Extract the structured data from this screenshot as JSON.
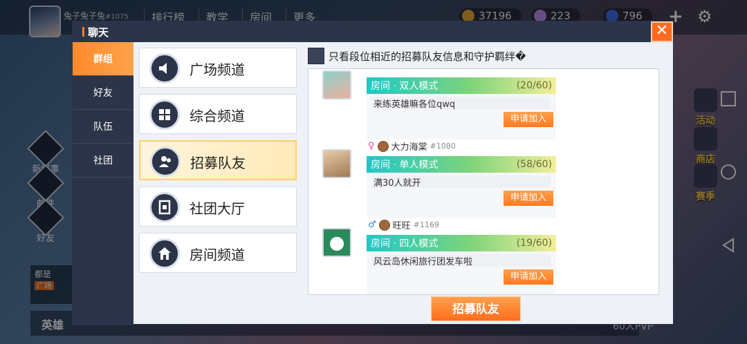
{
  "background": {
    "player_name": "兔子兔子兔",
    "player_uid": "#1075",
    "top_nav": [
      "排行榜",
      "教学",
      "房间",
      "更多"
    ],
    "currencies": [
      {
        "icon": "gold-coin-icon",
        "value": "37196",
        "color": "#e9a93a"
      },
      {
        "icon": "crystal-icon",
        "value": "223",
        "color": "#b98cf0"
      },
      {
        "icon": "gem-icon",
        "value": "796",
        "color": "#3a6ee9"
      }
    ],
    "left_items": [
      "新鲜事",
      "邮件",
      "好友"
    ],
    "right_items": [
      "活动",
      "商店",
      "赛季"
    ],
    "news_tag": "广场",
    "news_text": "都是",
    "bottom_label": "英雄",
    "pvp_label": "60人PVP"
  },
  "chat": {
    "title": "聊天",
    "close_label": "✕",
    "side_tabs": [
      {
        "label": "群组",
        "active": true
      },
      {
        "label": "好友",
        "active": false
      },
      {
        "label": "队伍",
        "active": false
      },
      {
        "label": "社团",
        "active": false
      }
    ],
    "channels": [
      {
        "label": "广场频道",
        "icon": "speaker-icon",
        "active": false
      },
      {
        "label": "综合频道",
        "icon": "grid-icon",
        "active": false
      },
      {
        "label": "招募队友",
        "icon": "users-icon",
        "active": true
      },
      {
        "label": "社团大厅",
        "icon": "bookmark-icon",
        "active": false
      },
      {
        "label": "房间频道",
        "icon": "home-icon",
        "active": false
      }
    ],
    "filter_label": "只看段位相近的招募队友信息和守护羁绊�",
    "messages": [
      {
        "name": "",
        "uid": "",
        "gender": "",
        "room_mode": "房间 · 双人模式",
        "room_count": "(20/60)",
        "text": "来练英雄嘛各位qwq",
        "join_label": "申请加入",
        "avatar_colors": [
          "#8fd1c8",
          "#e9b0a0"
        ]
      },
      {
        "name": "大力海棠",
        "uid": "#1080",
        "gender": "♀",
        "gender_color": "#e2499b",
        "room_mode": "房间 · 单人模式",
        "room_count": "(58/60)",
        "text": "满30人就开",
        "join_label": "申请加入",
        "avatar_colors": [
          "#e7c9a6",
          "#a07a55"
        ]
      },
      {
        "name": "旺旺",
        "uid": "#1169",
        "gender": "♂",
        "gender_color": "#2d82e0",
        "room_mode": "房间 · 四人模式",
        "room_count": "(19/60)",
        "text": "风云岛休闲旅行团发车啦",
        "join_label": "申请加入",
        "avatar_colors": [
          "#ffffff",
          "#2a8a5a"
        ]
      }
    ],
    "recruit_label": "招募队友"
  }
}
